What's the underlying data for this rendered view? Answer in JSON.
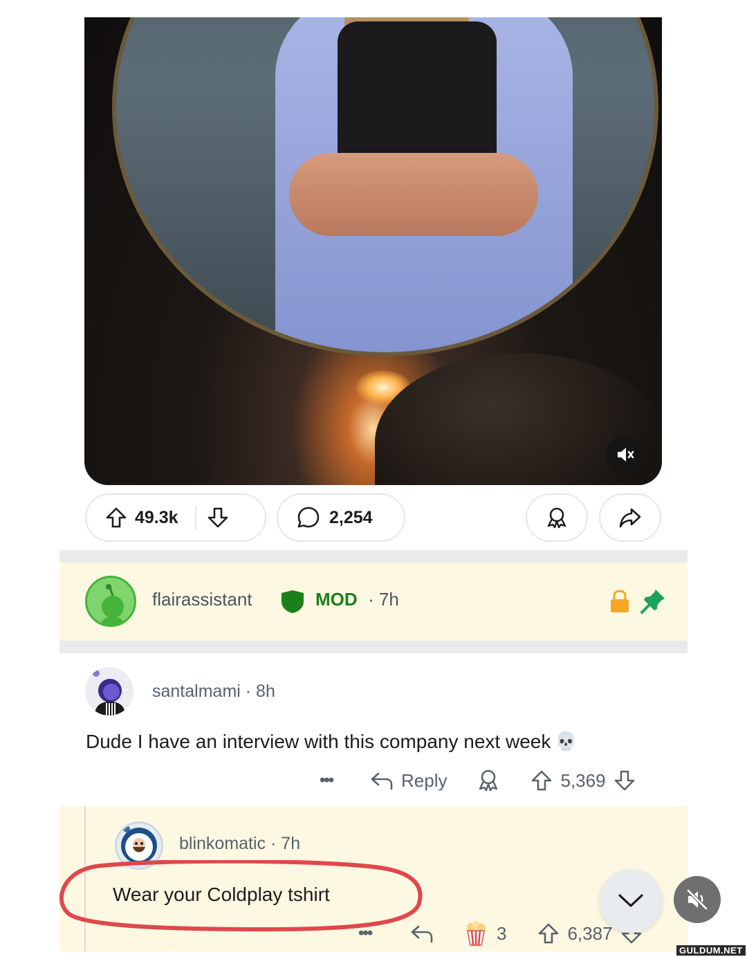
{
  "post": {
    "upvotes": "49.3k",
    "comments": "2,254"
  },
  "pinned": {
    "username": "flairassistant",
    "mod_label": "MOD",
    "time": "· 7h",
    "accent": "#1b7f1b",
    "lock_color": "#f5a623",
    "pin_color": "#1aa35a"
  },
  "comment1": {
    "username": "santalmami",
    "time": "· 8h",
    "text": "Dude I have an interview with this company next week",
    "emoji": "💀",
    "reply_label": "Reply",
    "score": "5,369",
    "more": "•••"
  },
  "comment2": {
    "username": "blinkomatic",
    "time": "· 7h",
    "text": "Wear your Coldplay tshirt",
    "award_count": "3",
    "score": "6,387",
    "more": "•••"
  },
  "watermark": "GULDUM.NET",
  "colors": {
    "background": "#ffffff",
    "highlight_bg": "#fdf8e1",
    "circle_annotation": "#e0474c"
  }
}
